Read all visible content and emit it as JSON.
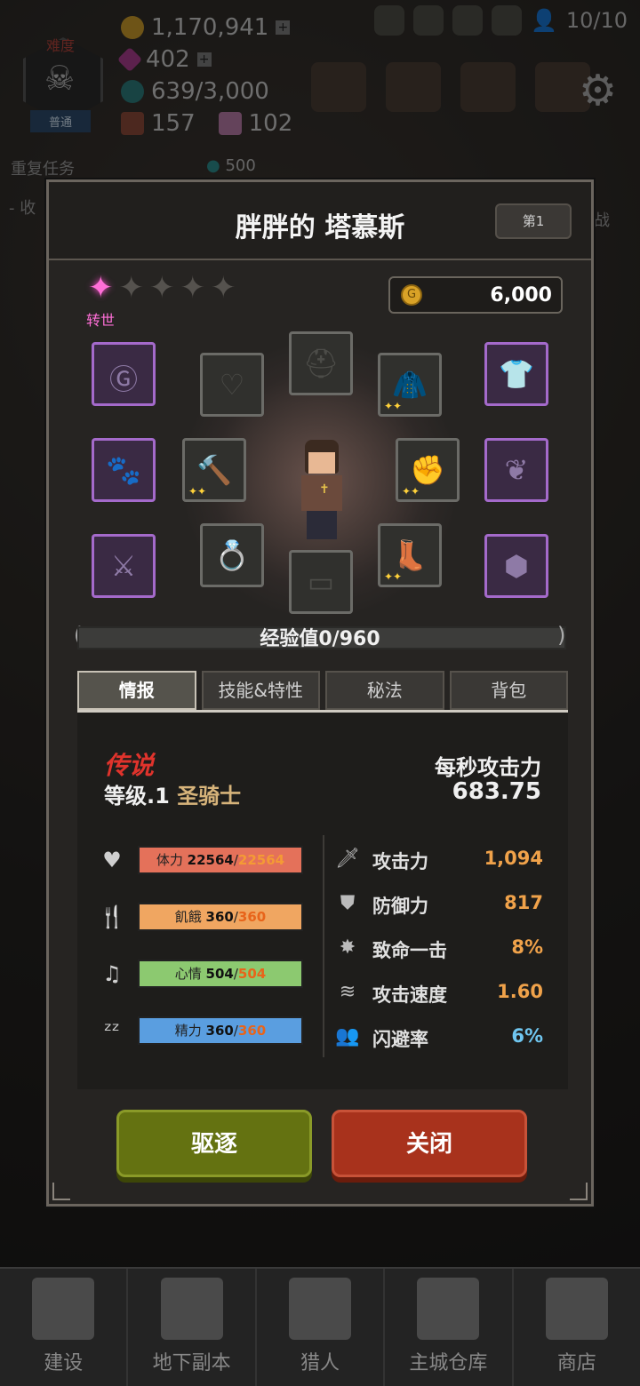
{
  "hud": {
    "difficulty_label": "难度",
    "difficulty_mode": "普通",
    "gold": "1,170,941",
    "gems": "402",
    "mana": "639/3,000",
    "chests": "157",
    "crystals": "102",
    "population": "10/10",
    "quest_label": "重复任务",
    "quest_reward": "500",
    "collect_prefix": "- 收",
    "battle_suffix": "战"
  },
  "dialog": {
    "title": "胖胖的 塔慕斯",
    "rank": "第1",
    "rebirth_label": "转世",
    "gold_cost": "6,000",
    "exp_text": "经验值0/960",
    "tabs": [
      "情报",
      "技能&特性",
      "秘法",
      "背包"
    ],
    "rarity": "传说",
    "level_text": "等级.1",
    "class_name": "圣骑士",
    "dps_label": "每秒攻击力",
    "dps_value": "683.75",
    "bars": {
      "hp": {
        "label": "体力",
        "current": "22564",
        "max": "22564"
      },
      "hunger": {
        "label": "飢餓",
        "current": "360",
        "max": "360"
      },
      "mood": {
        "label": "心情",
        "current": "504",
        "max": "504"
      },
      "energy": {
        "label": "精力",
        "current": "360",
        "max": "360"
      }
    },
    "stats": [
      {
        "name": "攻击力",
        "value": "1,094",
        "icon": "sword-icon"
      },
      {
        "name": "防御力",
        "value": "817",
        "icon": "shield-icon"
      },
      {
        "name": "致命一击",
        "value": "8%",
        "icon": "burst-icon"
      },
      {
        "name": "攻击速度",
        "value": "1.60",
        "icon": "speed-icon"
      },
      {
        "name": "闪避率",
        "value": "6%",
        "icon": "dodge-icon"
      }
    ],
    "expel_label": "驱逐",
    "close_label": "关闭"
  },
  "nav": [
    "建设",
    "地下副本",
    "猎人",
    "主城仓库",
    "商店"
  ],
  "colors": {
    "accent_pink": "#ff6fd8",
    "legend_red": "#e0332c",
    "stat_orange": "#f0a24a",
    "stat_blue": "#6fc6f0",
    "expel_green": "#647211",
    "close_red": "#a8321c"
  }
}
